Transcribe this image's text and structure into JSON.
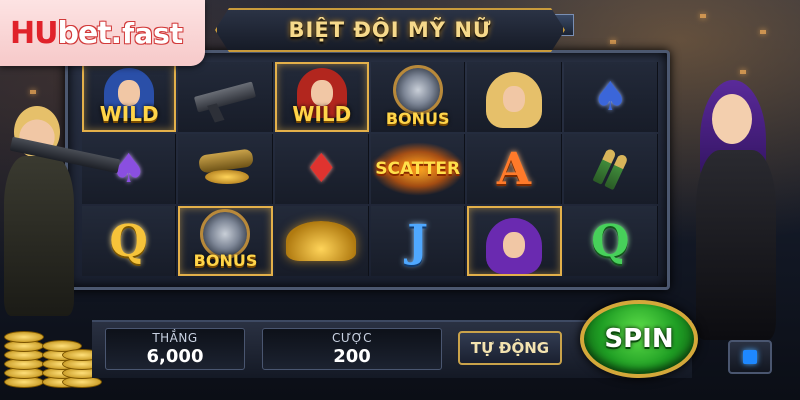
{
  "brand": {
    "logo_hu": "HU",
    "logo_bet": "bet",
    "logo_dot": ".",
    "logo_fast": "fast"
  },
  "game": {
    "title": "BIỆT ĐỘI MỸ NỮ"
  },
  "reels": [
    [
      {
        "symbol": "wild-woman-blue-hair",
        "label": "WILD",
        "highlight": true
      },
      {
        "symbol": "spade-purple",
        "label": "♠"
      },
      {
        "symbol": "letter-q-gold",
        "label": "Q"
      }
    ],
    [
      {
        "symbol": "pistol",
        "label": ""
      },
      {
        "symbol": "ammo-gold",
        "label": ""
      },
      {
        "symbol": "bonus-vault",
        "label": "BONUS",
        "highlight": true
      }
    ],
    [
      {
        "symbol": "wild-woman-red-hair",
        "label": "WILD",
        "highlight": true
      },
      {
        "symbol": "diamond-red",
        "label": "♦"
      },
      {
        "symbol": "gold-treasure",
        "label": ""
      }
    ],
    [
      {
        "symbol": "bonus-vault",
        "label": "BONUS"
      },
      {
        "symbol": "scatter",
        "label": "SCATTER"
      },
      {
        "symbol": "letter-j-blue",
        "label": "J"
      }
    ],
    [
      {
        "symbol": "woman-blonde",
        "label": ""
      },
      {
        "symbol": "letter-a-orange",
        "label": "A"
      },
      {
        "symbol": "woman-purple-hair",
        "label": "",
        "highlight": true
      }
    ],
    [
      {
        "symbol": "spade-blue",
        "label": "♠"
      },
      {
        "symbol": "bullets",
        "label": ""
      },
      {
        "symbol": "letter-q-green",
        "label": "Q"
      }
    ]
  ],
  "controls": {
    "win_label": "THẮNG",
    "win_value": "6,000",
    "bet_label": "CƯỢC",
    "bet_value": "200",
    "auto_label": "TỰ ĐỘNG",
    "spin_label": "SPIN"
  },
  "colors": {
    "accent_gold": "#c9a24a",
    "spin_green": "#1f9e24",
    "logo_red": "#e0222a"
  }
}
